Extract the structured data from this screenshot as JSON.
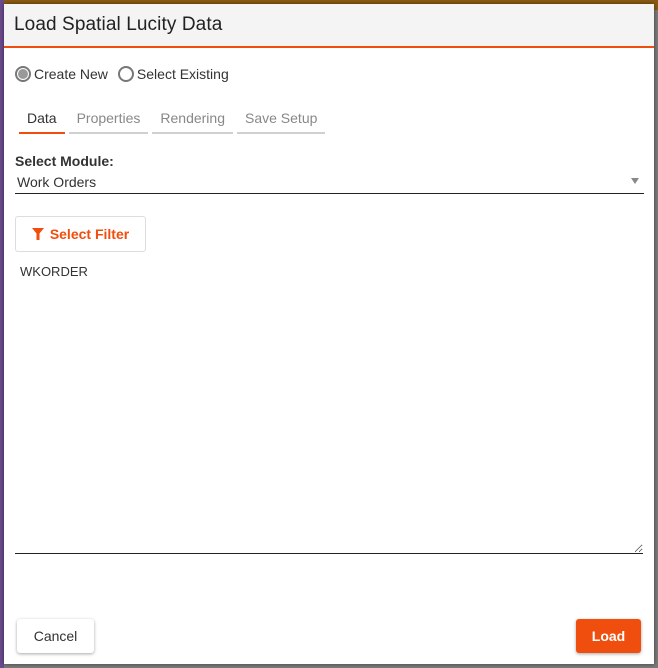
{
  "dialog": {
    "title": "Load Spatial Lucity Data"
  },
  "mode": {
    "options": [
      {
        "label": "Create New",
        "checked": true
      },
      {
        "label": "Select Existing",
        "checked": false
      }
    ]
  },
  "tabs": [
    {
      "label": "Data",
      "active": true
    },
    {
      "label": "Properties",
      "active": false
    },
    {
      "label": "Rendering",
      "active": false
    },
    {
      "label": "Save Setup",
      "active": false
    }
  ],
  "module": {
    "label": "Select Module:",
    "selected": "Work Orders"
  },
  "filter": {
    "button_label": "Select Filter",
    "icon": "filter-icon",
    "text": "WKORDER"
  },
  "footer": {
    "cancel_label": "Cancel",
    "load_label": "Load"
  },
  "colors": {
    "accent": "#f04e0e",
    "header_bg": "#f4f4f4"
  }
}
